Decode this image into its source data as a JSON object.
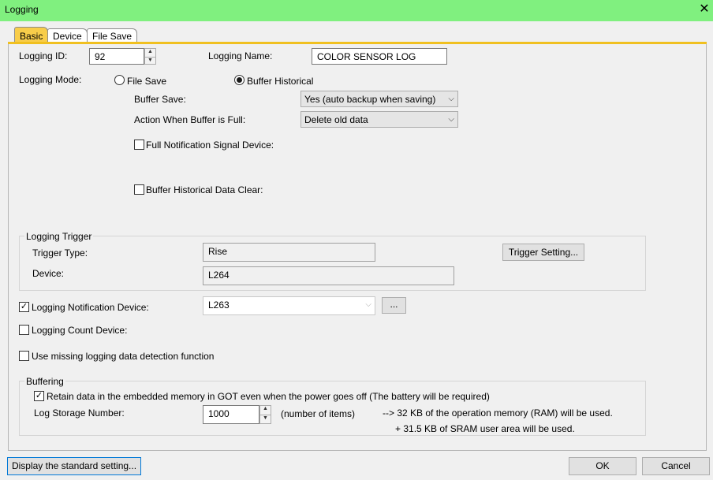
{
  "window": {
    "title": "Logging",
    "close_glyph": "✕"
  },
  "tabs": [
    "Basic",
    "Device",
    "File Save"
  ],
  "basic": {
    "logging_id_label": "Logging ID:",
    "logging_id_value": "92",
    "logging_name_label": "Logging Name:",
    "logging_name_value": "COLOR SENSOR LOG",
    "logging_mode_label": "Logging Mode:",
    "mode_file_save": "File Save",
    "mode_buffer_historical": "Buffer Historical",
    "selected_mode": "Buffer Historical",
    "buffer_save_label": "Buffer Save:",
    "buffer_save_value": "Yes (auto backup when saving)",
    "action_full_label": "Action When Buffer is Full:",
    "action_full_value": "Delete old data",
    "full_notification_label": "Full Notification Signal Device:",
    "full_notification_checked": false,
    "buffer_clear_label": "Buffer Historical Data Clear:",
    "buffer_clear_checked": false
  },
  "trigger": {
    "group_label": "Logging Trigger",
    "type_label": "Trigger Type:",
    "type_value": "Rise",
    "device_label": "Device:",
    "device_value": "L264",
    "setting_button": "Trigger Setting..."
  },
  "notification": {
    "label": "Logging Notification Device:",
    "checked": true,
    "value": "L263",
    "browse_button": "..."
  },
  "count_device": {
    "label": "Logging Count Device:",
    "checked": false
  },
  "missing_detection": {
    "label": "Use missing logging data detection function",
    "checked": false
  },
  "buffering": {
    "group_label": "Buffering",
    "retain_label": "Retain data in the embedded memory in GOT even when the power goes off (The battery will be required)",
    "retain_checked": true,
    "storage_label": "Log Storage Number:",
    "storage_value": "1000",
    "storage_unit": "(number of items)",
    "ram_note": "--> 32 KB of the operation memory (RAM) will be used.",
    "sram_note": "+ 31.5 KB of SRAM user area will be used."
  },
  "footer": {
    "standard_button": "Display the standard setting...",
    "ok_button": "OK",
    "cancel_button": "Cancel"
  },
  "icons": {
    "check_glyph": "✓",
    "dropdown_glyph": "⌵",
    "spin_up": "▲",
    "spin_down": "▼"
  },
  "colors": {
    "titlebar": "#80f07f",
    "active_tab": "#f8cd4a",
    "focus_border": "#0078d7"
  }
}
